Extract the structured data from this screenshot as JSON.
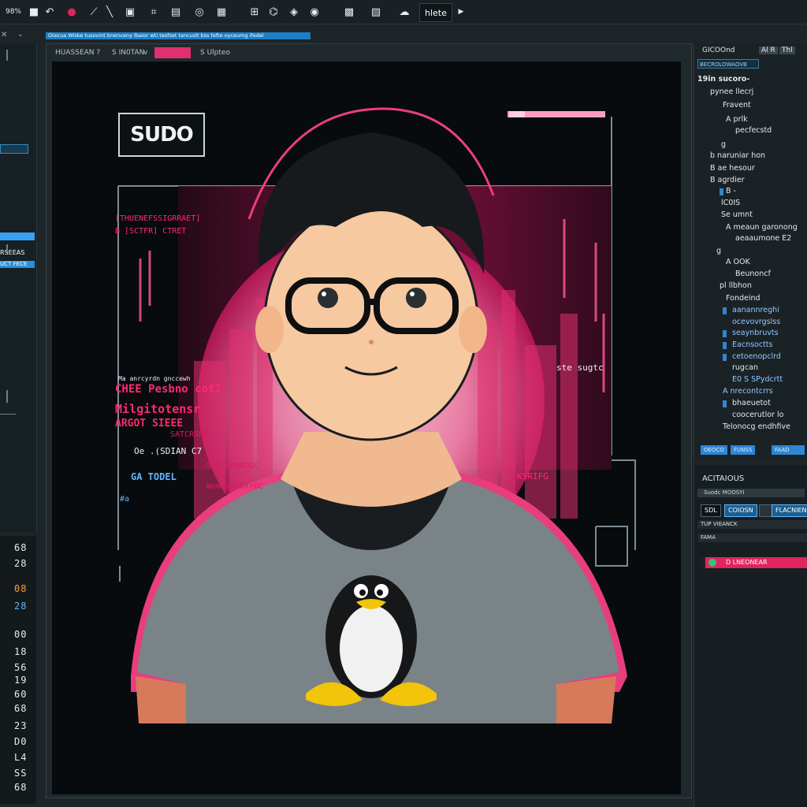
{
  "toolbar": {
    "zoom_label": "98%",
    "tools": [
      "square-icon",
      "undo-icon",
      "color-icon",
      "line-tool-icon",
      "slash-tool-icon",
      "frame-icon",
      "crop-icon",
      "pen-icon",
      "layer-icon",
      "brush-icon",
      "grid-icon",
      "lasso-icon",
      "target-icon",
      "image-icon",
      "map-icon",
      "cloud-icon",
      "play-icon"
    ],
    "active_label": "hlete"
  },
  "notice": {
    "text": "Gtecua Wiske tusovint bnenvany lbaior wti tesfset tancuslt bss fefte oyceumg ifedel"
  },
  "left_panel": {
    "badge": "",
    "cases_label": "RSEEAS",
    "select_label": "UCT FECE",
    "line_numbers": [
      "68",
      "28",
      "08",
      "28",
      "00",
      "18",
      "56",
      "19",
      "60",
      "68",
      "23",
      "D0",
      "L4",
      "SS",
      "68"
    ]
  },
  "canvas_tabs": {
    "tab1": "HUASSEAN ?",
    "tab2": "S  IN0TAN",
    "tab3": "v",
    "active_tab": "",
    "tab4": "S Ulpteo"
  },
  "artwork": {
    "sign_text": "SUDO",
    "code_lines": [
      "[THUENEFSSIGRRAET]",
      "B [SCTFR] CTRET",
      "Ma anrcyrdn gnccewh",
      "CHEE Pesbno cotI",
      "Milgitotensr",
      "ARGOT SIEEE",
      "SATCRSHN",
      "Oe .(SDIAN C7",
      "GA TODEL",
      "CaADLE",
      "#a",
      "KSRIFG",
      "SOT hPONOSC",
      "Wnm bUnDTrOC",
      "LSCPGT FSIS",
      "ste  sugtc"
    ]
  },
  "right_panel": {
    "tabs": [
      "GICOOnd",
      "Al R",
      "Thl"
    ],
    "header": "BECROLOWAOVB",
    "tree_items": [
      "19in sucoro-",
      "pynee llecrj",
      "Fravent",
      "A prlk",
      "pecfecstd",
      "g",
      "b naruniar hon",
      "B ae hesour",
      "B agrdier",
      "B -",
      "lC0IS",
      "Se umnt",
      "A meaun garonong",
      "aeaaumone E2",
      "g",
      "A OOK",
      "Beunoncf",
      "pl llbhon",
      "Fondeind",
      "aanannreghi",
      "ocevovrgslss",
      "seaynbruvts",
      "Eacnsoctts",
      "cetoenopclrd",
      "rugcan",
      "E0 S SPydcrtt",
      "A nrecontcrrs",
      "bhaeuetot",
      "coocerutlor lo",
      "Telonocg endhfive"
    ],
    "bottom_buttons": [
      "OEOCO",
      "FUNSS",
      "FAAD"
    ]
  },
  "properties": {
    "title": "ACITAIOUS",
    "field1": "Suodc MOOSYI",
    "chip1": "SDL",
    "chip2": "COIOSN",
    "chip3": "",
    "chip4": "FLACNIEN",
    "field2": "TUP VIEANCK",
    "field3": "FAMA",
    "status": "D LNEONEAR"
  },
  "colors": {
    "accent_pink": "#e0245e",
    "accent_blue": "#2e86d4",
    "background": "#1e2529",
    "canvas": "#070b0d"
  }
}
